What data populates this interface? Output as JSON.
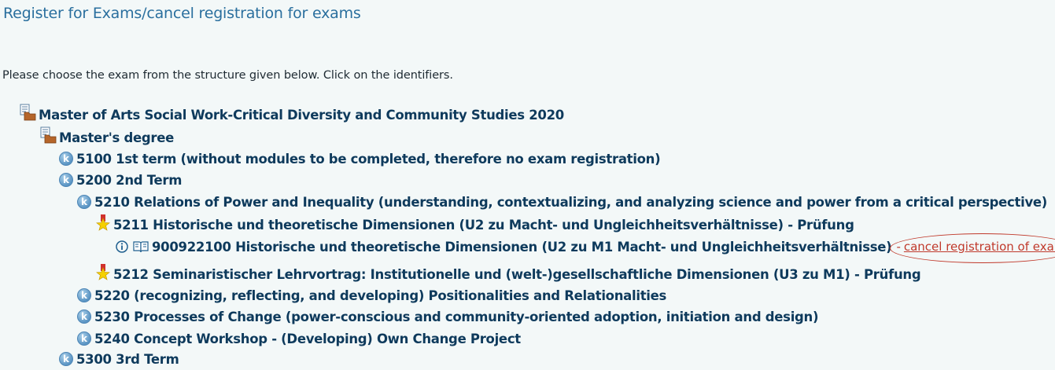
{
  "page_title": "Register for Exams/cancel registration for exams",
  "intro_text": "Please choose the exam from the structure given below. Click on the identifiers.",
  "tree": {
    "program": "Master of Arts Social Work-Critical Diversity and Community Studies 2020",
    "degree": "Master's degree",
    "term_5100": "5100 1st term (without modules to be completed, therefore no exam registration)",
    "term_5200": "5200 2nd Term",
    "module_5210": "5210 Relations of Power and Inequality (understanding, contextualizing, and analyzing science and power from a critical perspective)",
    "exam_5211": "5211 Historische und theoretische Dimensionen (U2 zu Macht- und Ungleichheitsverhältnisse) - Prüfung",
    "exam_900922100": "900922100 Historische und theoretische Dimensionen (U2 zu M1 Macht- und Ungleichheitsverhältnisse)",
    "cancel_dash": "-",
    "cancel_label": "cancel registration of exam",
    "exam_5212": "5212 Seminaristischer Lehrvortrag: Institutionelle und (welt-)gesellschaftliche Dimensionen (U3 zu M1) - Prüfung",
    "module_5220": "5220 (recognizing, reflecting, and developing) Positionalities and Relationalities",
    "module_5230": "5230 Processes of Change (power-conscious and community-oriented adoption, initiation and design)",
    "module_5240": "5240 Concept Workshop - (Developing) Own Change Project",
    "term_5300": "5300 3rd Term"
  },
  "icons": {
    "k_letter": "k",
    "folder": "folder-icon",
    "k": "k-icon",
    "star": "star-icon",
    "info": "info-icon",
    "book": "book-icon"
  },
  "colors": {
    "background": "#f3f8f8",
    "title": "#2a6f9e",
    "tree_text": "#0e3a5c",
    "cancel": "#c0392b"
  }
}
